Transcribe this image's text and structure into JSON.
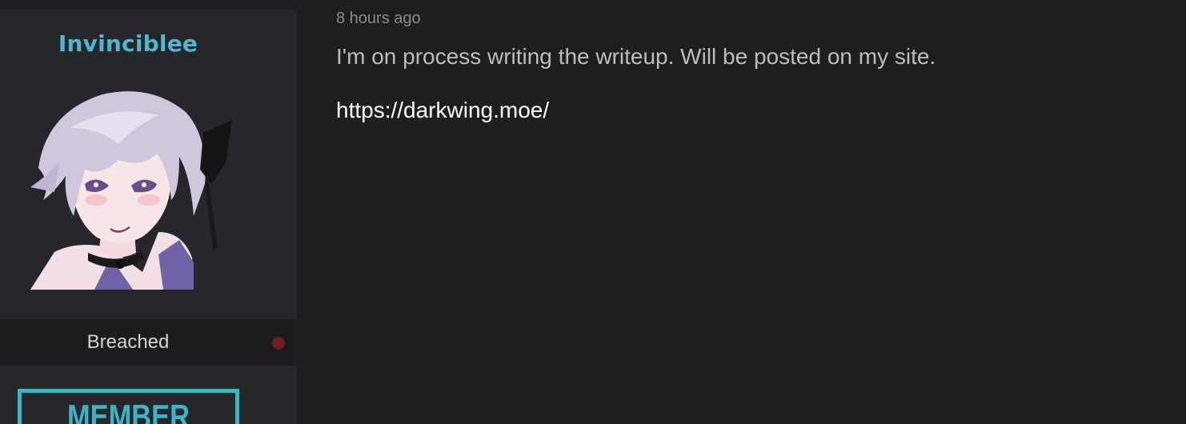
{
  "author": {
    "username": "Invinciblee",
    "rank": "Breached",
    "badge_text": "MEMBER",
    "colors": {
      "username": "#4eb7cf",
      "status_dot": "#6e1f1f",
      "badge": "#3fb3c3"
    },
    "avatar_icon": "anime-avatar-icon"
  },
  "post": {
    "time": "8 hours ago",
    "message": "I'm on process writing the writeup. Will be posted on my site.",
    "link": "https://darkwing.moe/"
  }
}
